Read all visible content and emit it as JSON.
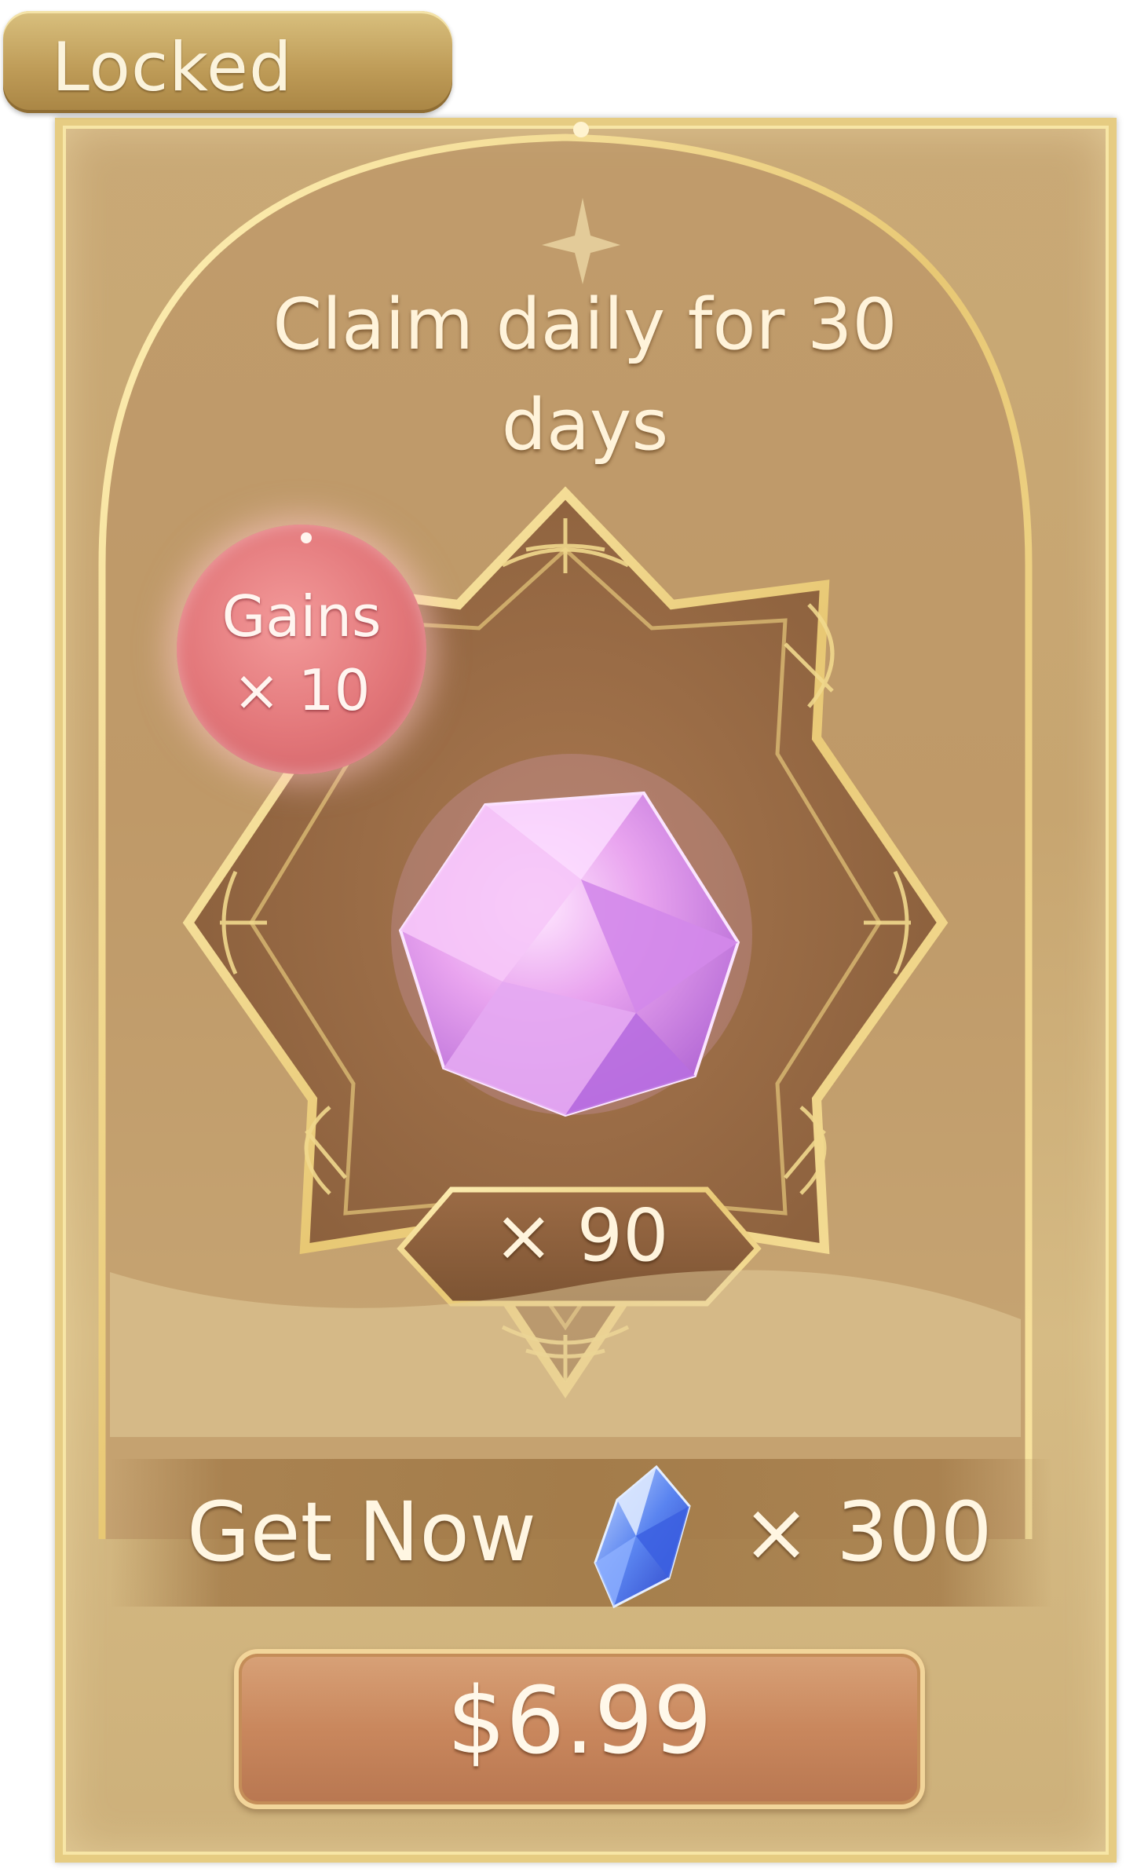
{
  "status_tab": {
    "label": "Locked"
  },
  "offer": {
    "description": "Claim daily for 30 days",
    "gains_badge": {
      "line1": "Gains",
      "line2": "× 10"
    },
    "item_icon": "pink-crystal-icon",
    "item_quantity": "× 90",
    "get_now": {
      "label": "Get Now",
      "currency_icon": "blue-crystal-icon",
      "cost": "× 300"
    },
    "price": "$6.99"
  },
  "colors": {
    "card_gold": "#c9a976",
    "frame_gold": "#e6cc82",
    "badge_pink": "#e27679",
    "price_button": "#c9875d",
    "text_cream": "#fff3da"
  }
}
